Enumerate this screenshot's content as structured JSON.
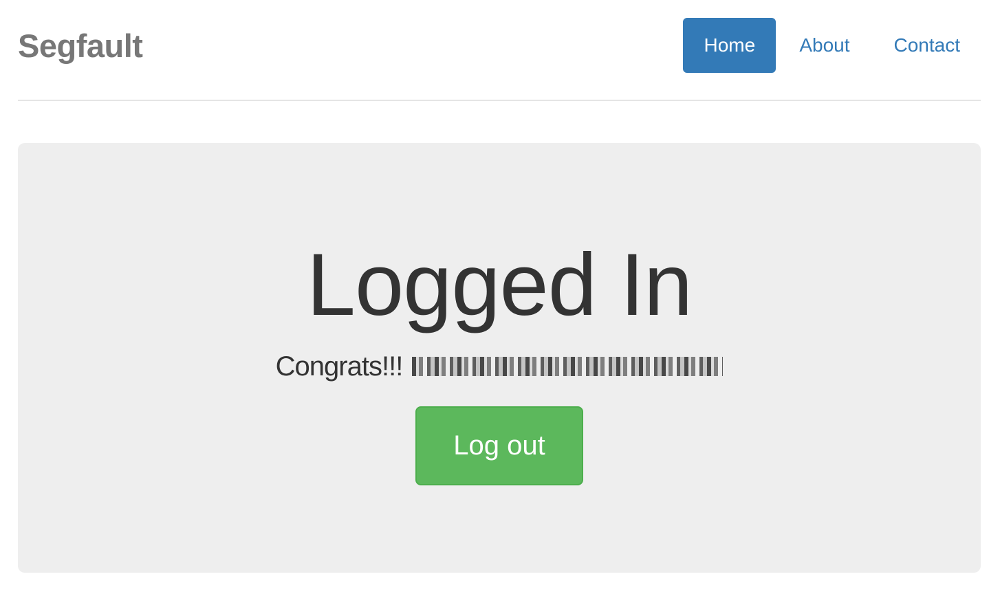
{
  "header": {
    "brand": "Segfault",
    "nav": [
      {
        "label": "Home",
        "active": true
      },
      {
        "label": "About",
        "active": false
      },
      {
        "label": "Contact",
        "active": false
      }
    ]
  },
  "jumbotron": {
    "title": "Logged In",
    "message": "Congrats!!!",
    "logout_label": "Log out"
  },
  "colors": {
    "primary": "#337ab7",
    "success": "#5cb85c",
    "jumbotron_bg": "#eeeeee",
    "brand_text": "#777777"
  }
}
